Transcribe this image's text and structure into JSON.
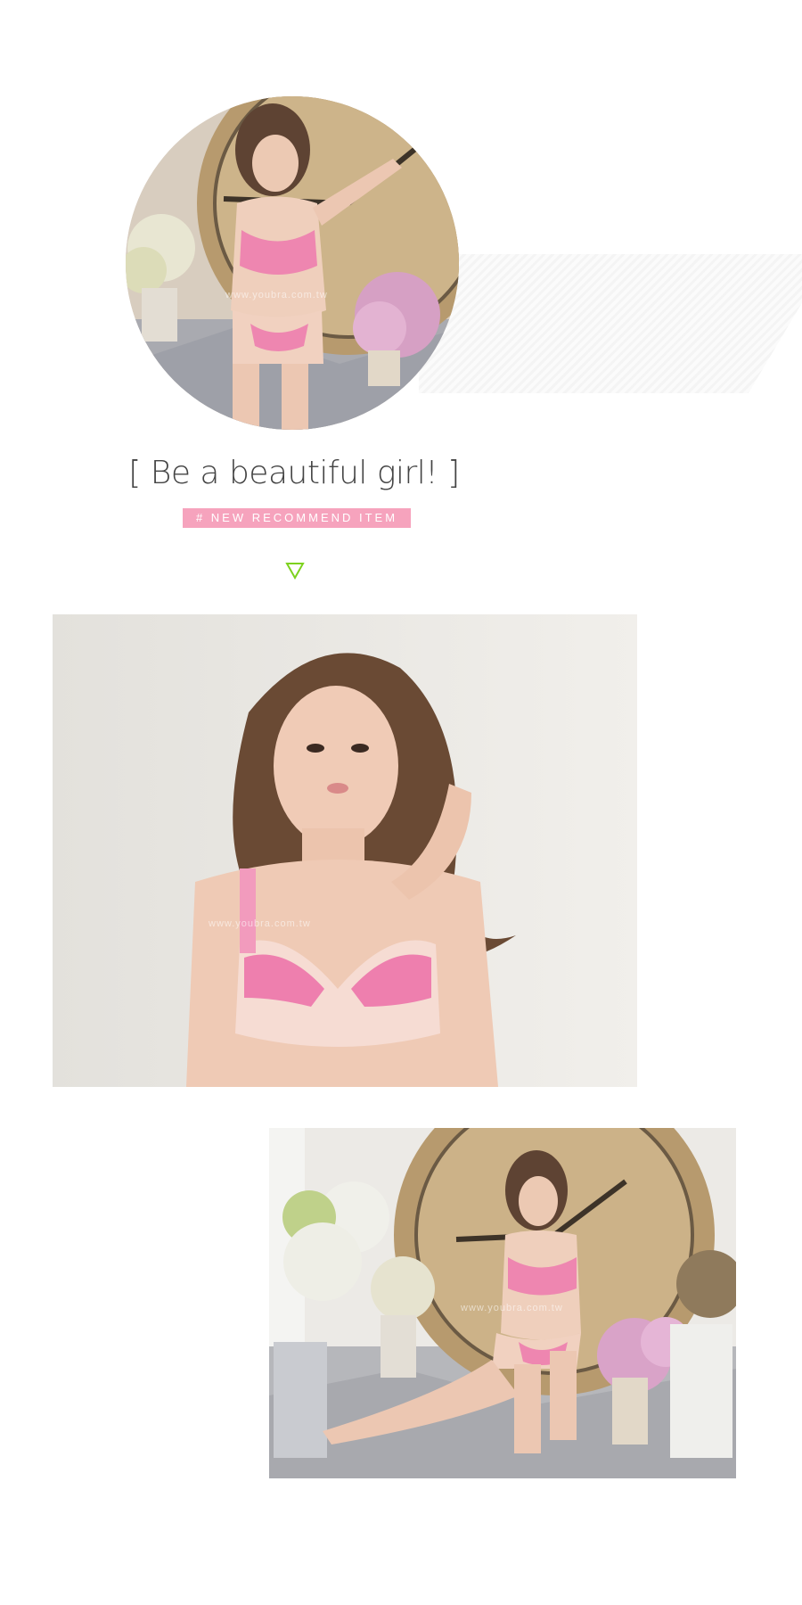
{
  "headline": "[ Be a beautiful girl! ]",
  "tag": "# NEW RECOMMEND ITEM",
  "watermark": "www.youbra.com.tw",
  "colors": {
    "tag_bg": "#f6a3bd",
    "arrow": "#7dd21e",
    "text": "#444444"
  },
  "icons": {
    "arrow": "triangle-down-outline-icon"
  }
}
